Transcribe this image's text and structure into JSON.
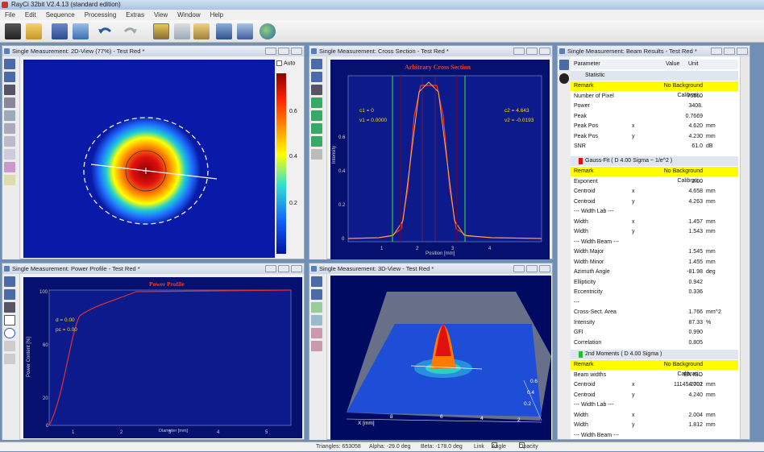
{
  "app_title": "RayCi 32bit V2.4.13 (standard edition)",
  "menu": [
    "File",
    "Edit",
    "Sequence",
    "Processing",
    "Extras",
    "View",
    "Window",
    "Help"
  ],
  "panel_2d": {
    "title": "Single Measurement: 2D-View (77%) - Test Red *",
    "auto_label": "Auto",
    "colorbar_ticks": [
      "0.6",
      "0.4",
      "0.2"
    ]
  },
  "panel_cross": {
    "title": "Single Measurement: Cross Section - Test Red *",
    "chart_title": "Arbitrary Cross Section",
    "c1": "c1 = 0",
    "v1": "v1 = 0.0000",
    "c2": "c2 = 4.643",
    "v2": "v2 = -0.0193",
    "ylabel": "Intensity",
    "xlabel": "Position [mm]"
  },
  "panel_power": {
    "title": "Single Measurement: Power Profile - Test Red *",
    "chart_title": "Power Profile",
    "d": "d = 0.00",
    "pc": "pc = 0.00",
    "ylabel": "Power Content [%]",
    "xlabel": "Diameter [mm]"
  },
  "panel_3d": {
    "title": "Single Measurement: 3D-View - Test Red *",
    "xaxis": "X [mm]",
    "xticks": [
      "8",
      "6",
      "4",
      "2"
    ],
    "zticks": [
      "0.6",
      "0.4",
      "0.2"
    ]
  },
  "panel_results": {
    "title": "Single Measurement: Beam Results - Test Red *",
    "headers": {
      "param": "Parameter",
      "value": "Value",
      "unit": "Unit"
    },
    "sections": {
      "statistic": "Statistic",
      "gauss": "Gauss-Fit ( D 4.00 Sigma ~ 1/e^2 )",
      "moments": "2nd Moments ( D 4.00 Sigma )"
    },
    "rows_stat": [
      {
        "p": "Remark",
        "a": "",
        "v": "No Background Calibrati...",
        "u": ""
      },
      {
        "p": "Number of Pixel",
        "a": "",
        "v": "76560",
        "u": ""
      },
      {
        "p": "Power",
        "a": "",
        "v": "3408.",
        "u": ""
      },
      {
        "p": "Peak",
        "a": "",
        "v": "0.7669",
        "u": ""
      },
      {
        "p": "Peak Pos",
        "a": "x",
        "v": "4.620",
        "u": "mm"
      },
      {
        "p": "Peak Pos",
        "a": "y",
        "v": "4.230",
        "u": "mm"
      },
      {
        "p": "SNR",
        "a": "",
        "v": "61.0",
        "u": "dB"
      }
    ],
    "rows_gauss": [
      {
        "p": "Remark",
        "a": "",
        "v": "No Background Calibrati...",
        "u": ""
      },
      {
        "p": "Exponent",
        "a": "",
        "v": "2.00",
        "u": ""
      },
      {
        "p": "Centroid",
        "a": "x",
        "v": "4.658",
        "u": "mm"
      },
      {
        "p": "Centroid",
        "a": "y",
        "v": "4.263",
        "u": "mm"
      },
      {
        "p": "--- Width Lab ---",
        "a": "",
        "v": "",
        "u": ""
      },
      {
        "p": "Width",
        "a": "x",
        "v": "1.457",
        "u": "mm"
      },
      {
        "p": "Width",
        "a": "y",
        "v": "1.543",
        "u": "mm"
      },
      {
        "p": "--- Width Beam ---",
        "a": "",
        "v": "",
        "u": ""
      },
      {
        "p": "Width Major",
        "a": "",
        "v": "1.545",
        "u": "mm"
      },
      {
        "p": "Width Minor",
        "a": "",
        "v": "1.455",
        "u": "mm"
      },
      {
        "p": "Azimuth Angle",
        "a": "",
        "v": "-81.98",
        "u": "deg"
      },
      {
        "p": "Ellipticity",
        "a": "",
        "v": "0.942",
        "u": ""
      },
      {
        "p": "Eccentricity",
        "a": "",
        "v": "0.336",
        "u": ""
      },
      {
        "p": "---",
        "a": "",
        "v": "",
        "u": ""
      },
      {
        "p": "Cross-Sect. Area",
        "a": "",
        "v": "1.766",
        "u": "mm^2"
      },
      {
        "p": "Intensity",
        "a": "",
        "v": "87.33",
        "u": "%"
      },
      {
        "p": "GFI",
        "a": "",
        "v": "0.990",
        "u": ""
      },
      {
        "p": "Correlation",
        "a": "",
        "v": "0.805",
        "u": ""
      }
    ],
    "rows_moments": [
      {
        "p": "Remark",
        "a": "",
        "v": "No Background Calibrati...",
        "u": ""
      },
      {
        "p": "Beam widths",
        "a": "",
        "v": "EN ISO 11145:2001",
        "u": ""
      },
      {
        "p": "Centroid",
        "a": "x",
        "v": "4.702",
        "u": "mm"
      },
      {
        "p": "Centroid",
        "a": "y",
        "v": "4.240",
        "u": "mm"
      },
      {
        "p": "--- Width Lab ---",
        "a": "",
        "v": "",
        "u": ""
      },
      {
        "p": "Width",
        "a": "x",
        "v": "2.004",
        "u": "mm"
      },
      {
        "p": "Width",
        "a": "y",
        "v": "1.812",
        "u": "mm"
      },
      {
        "p": "--- Width Beam ---",
        "a": "",
        "v": "",
        "u": ""
      }
    ]
  },
  "status": {
    "triangles": "Triangles: 653058",
    "alpha": "Alpha: -29.0 deg",
    "beta": "Beta: -178.0 deg",
    "link": "Link",
    "angle": "Angle",
    "opacity": "Opacity"
  },
  "colors": {
    "accent": "#fffb00",
    "heatmap_bg": "#0a1aa8",
    "plot_bg": "#0c1a8c"
  },
  "icons": [
    "save-icon",
    "folder-open-icon",
    "camera-icon",
    "undo-icon",
    "redo-icon",
    "globe-icon",
    "crosshair-icon",
    "zoom-icon",
    "eye-icon"
  ]
}
